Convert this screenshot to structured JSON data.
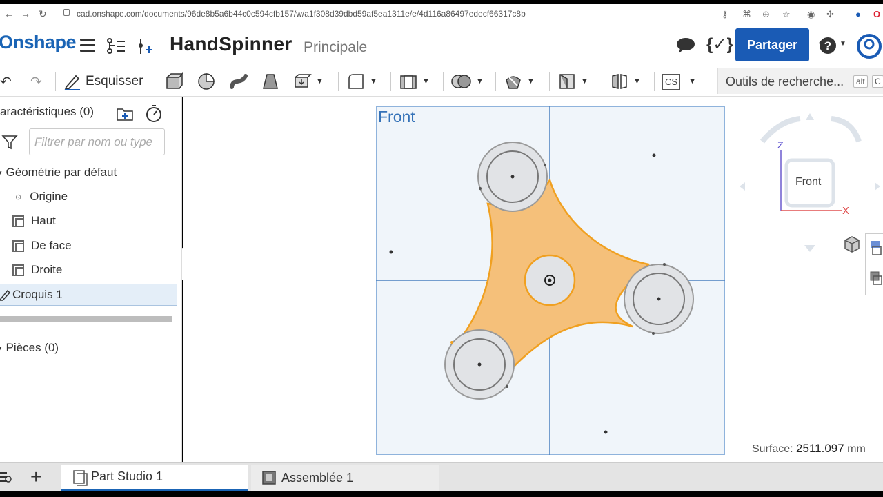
{
  "browser": {
    "url": "cad.onshape.com/documents/96de8b5a6b44c0c594cfb157/w/a1f308d39dbd59af5ea1311e/e/4d116a86497edecf66317c8b"
  },
  "app": {
    "logo": "Onshape",
    "document_title": "HandSpinner",
    "branch": "Principale",
    "share_label": "Partager",
    "accent_color": "#1a5bb5"
  },
  "toolbar": {
    "sketch_label": "Esquisser",
    "search_tools_label": "Outils de recherche...",
    "search_shortcut_1": "alt",
    "search_shortcut_2": "C",
    "cs_label": "CS"
  },
  "feature_panel": {
    "header": "aractéristiques (0)",
    "filter_placeholder": "Filtrer par nom ou type",
    "default_geometry": "Géométrie par défaut",
    "items": [
      {
        "label": "Origine",
        "icon": "origin-icon"
      },
      {
        "label": "Haut",
        "icon": "plane-icon"
      },
      {
        "label": "De face",
        "icon": "plane-icon"
      },
      {
        "label": "Droite",
        "icon": "plane-icon"
      }
    ],
    "selected_feature": "Croquis 1",
    "parts": "Pièces (0)"
  },
  "viewport": {
    "plane_label": "Front",
    "view_cube_face": "Front",
    "axis_z": "Z",
    "axis_x": "X",
    "surface_label": "Surface:",
    "surface_value": "2511.097",
    "surface_unit": "mm",
    "sketch_fill_color": "#f5c07a",
    "sketch_stroke_color": "#f0a020"
  },
  "tabs": [
    {
      "label": "Part Studio 1",
      "active": true
    },
    {
      "label": "Assemblée 1",
      "active": false
    }
  ]
}
